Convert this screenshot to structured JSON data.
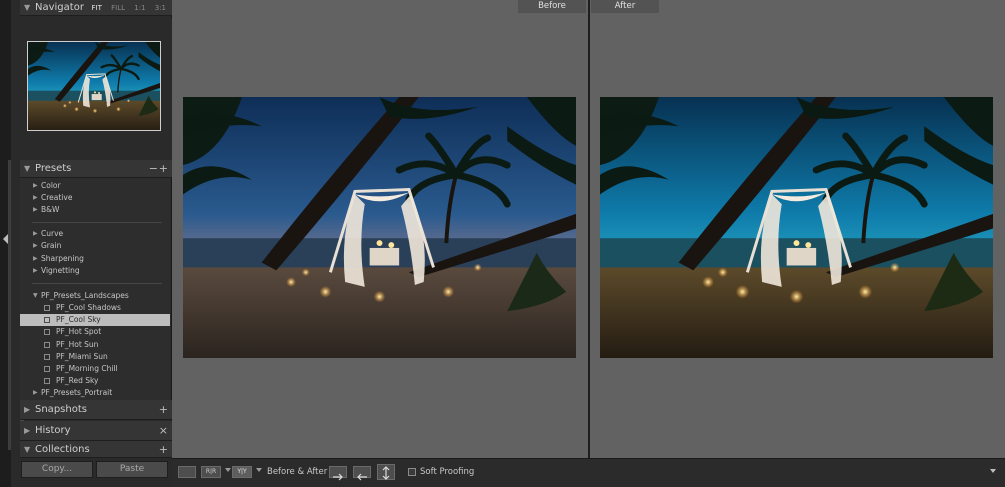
{
  "navigator": {
    "title": "Navigator",
    "modes": [
      "FIT",
      "FILL",
      "1:1",
      "3:1"
    ],
    "active_mode": "FIT"
  },
  "presets": {
    "title": "Presets",
    "minus": "−",
    "plus": "+",
    "groups_basic": [
      "Color",
      "Creative",
      "B&W"
    ],
    "groups_effects": [
      "Curve",
      "Grain",
      "Sharpening",
      "Vignetting"
    ],
    "folder_open": "PF_Presets_Landscapes",
    "children": [
      "PF_Cool Shadows",
      "PF_Cool Sky",
      "PF_Hot Spot",
      "PF_Hot Sun",
      "PF_Miami Sun",
      "PF_Morning Chill",
      "PF_Red Sky"
    ],
    "selected_child": "PF_Cool Sky",
    "folder_closed": "PF_Presets_Portrait"
  },
  "panels": {
    "snapshots": "Snapshots",
    "snapshots_btn": "+",
    "history": "History",
    "history_btn": "×",
    "collections": "Collections",
    "collections_btn": "+"
  },
  "buttons": {
    "copy": "Copy...",
    "paste": "Paste"
  },
  "view": {
    "before_label": "Before",
    "after_label": "After"
  },
  "toolbar": {
    "view_rr": "R|R",
    "view_yy": "Y|Y",
    "before_after_label": "Before & After :",
    "soft_proofing": "Soft Proofing"
  },
  "colors": {
    "selected_row": "#bdbdbd",
    "panel_bg": "#2a2a2a",
    "view_bg": "#626262"
  }
}
